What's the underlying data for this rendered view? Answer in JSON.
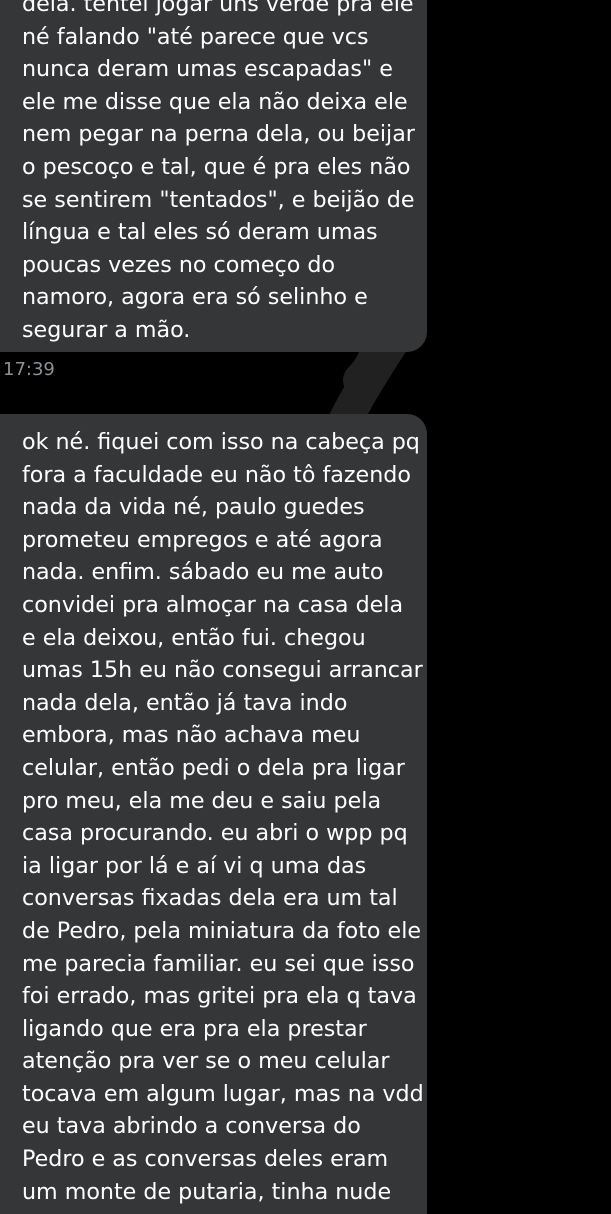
{
  "messages": [
    {
      "lines": [
        "dela. tentei jogar uns verde pra ele",
        "né falando \"até parece que vcs",
        "nunca deram umas escapadas\" e",
        "ele me disse que ela não deixa ele",
        "nem pegar na perna dela, ou beijar",
        "o pescoço e tal, que é pra eles não",
        "se sentirem \"tentados\", e beijão de",
        "língua e tal eles só deram umas",
        "poucas vezes no começo do",
        "namoro, agora era só selinho e",
        "segurar a mão."
      ],
      "time": "17:39"
    },
    {
      "lines": [
        "ok né. fiquei com isso na cabeça pq",
        "fora a faculdade eu não tô fazendo",
        "nada da vida né, paulo guedes",
        "prometeu empregos e até agora",
        "nada. enfim. sábado eu me auto",
        "convidei pra almoçar na casa dela",
        "e ela deixou, então fui. chegou",
        "umas 15h eu não consegui arrancar",
        "nada dela, então já tava indo",
        "embora, mas não achava meu",
        "celular, então pedi o dela pra ligar",
        "pro meu, ela me deu e saiu pela",
        "casa procurando. eu abri o wpp pq",
        "ia ligar por lá e aí vi q uma das",
        "conversas fixadas dela era um tal",
        "de Pedro, pela miniatura da foto ele",
        "me parecia familiar. eu sei que isso",
        "foi errado, mas gritei pra ela q tava",
        "ligando que era pra ela prestar",
        "atenção pra ver se o meu celular",
        "tocava em algum lugar, mas na vdd",
        "eu tava abrindo a conversa do",
        "Pedro e as conversas deles eram",
        "um monte de putaria, tinha nude"
      ]
    }
  ],
  "colors": {
    "background": "#000000",
    "bubble": "#343638",
    "text": "#ffffff",
    "timestamp": "#8b9298"
  }
}
